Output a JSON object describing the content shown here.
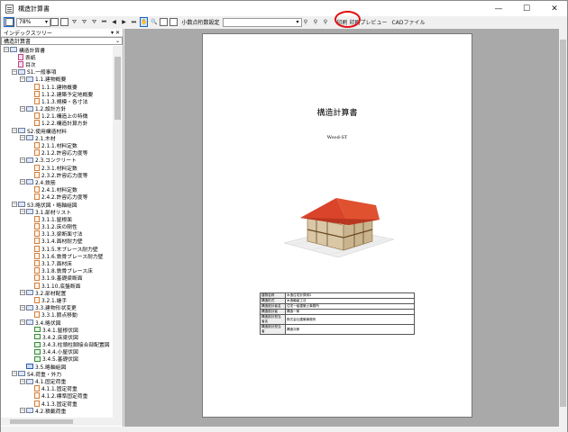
{
  "window": {
    "title": "構造計算書",
    "minimize": "—",
    "maximize": "☐",
    "close": "✕"
  },
  "toolbar": {
    "zoom": "78%",
    "decimal_label": "小数点桁数設定",
    "decimal_value": "",
    "print_label": "印刷",
    "preview_label": "印刷プレビュー",
    "cad_label": "CADファイル",
    "nav_icons": [
      "⏮",
      "◀",
      "▶",
      "⏭"
    ]
  },
  "panel": {
    "title": "インデックスツリー",
    "pin": "▾ ✕",
    "root": "構造計算書"
  },
  "tree": [
    {
      "lv": 0,
      "exp": "−",
      "icon": "folder",
      "label": "構造計算書"
    },
    {
      "lv": 1,
      "exp": "",
      "icon": "pink",
      "label": "表紙"
    },
    {
      "lv": 1,
      "exp": "",
      "icon": "pink",
      "label": "目次"
    },
    {
      "lv": 1,
      "exp": "−",
      "icon": "folder",
      "label": "S1.一般事項"
    },
    {
      "lv": 2,
      "exp": "−",
      "icon": "folder",
      "label": "1.1.建物概要"
    },
    {
      "lv": 3,
      "exp": "",
      "icon": "doc",
      "label": "1.1.1.建物概要"
    },
    {
      "lv": 3,
      "exp": "",
      "icon": "doc",
      "label": "1.1.2.建築予定地概要"
    },
    {
      "lv": 3,
      "exp": "",
      "icon": "doc",
      "label": "1.1.3.規模・各寸法"
    },
    {
      "lv": 2,
      "exp": "−",
      "icon": "folder",
      "label": "1.2.設計方針"
    },
    {
      "lv": 3,
      "exp": "",
      "icon": "doc",
      "label": "1.2.1.構造上の特徴"
    },
    {
      "lv": 3,
      "exp": "",
      "icon": "doc",
      "label": "1.2.2.構造計算方針"
    },
    {
      "lv": 1,
      "exp": "−",
      "icon": "folder",
      "label": "S2.使用構造材料"
    },
    {
      "lv": 2,
      "exp": "−",
      "icon": "folder",
      "label": "2.1.木材"
    },
    {
      "lv": 3,
      "exp": "",
      "icon": "doc",
      "label": "2.1.1.材料定数"
    },
    {
      "lv": 3,
      "exp": "",
      "icon": "doc",
      "label": "2.1.2.許容応力度等"
    },
    {
      "lv": 2,
      "exp": "−",
      "icon": "folder",
      "label": "2.3.コンクリート"
    },
    {
      "lv": 3,
      "exp": "",
      "icon": "doc",
      "label": "2.3.1.材料定数"
    },
    {
      "lv": 3,
      "exp": "",
      "icon": "doc",
      "label": "2.3.2.許容応力度等"
    },
    {
      "lv": 2,
      "exp": "−",
      "icon": "folder",
      "label": "2.4.鉄筋"
    },
    {
      "lv": 3,
      "exp": "",
      "icon": "doc",
      "label": "2.4.1.材料定数"
    },
    {
      "lv": 3,
      "exp": "",
      "icon": "doc",
      "label": "2.4.2.許容応力度等"
    },
    {
      "lv": 1,
      "exp": "−",
      "icon": "folder",
      "label": "S3.略伏図・略軸組図"
    },
    {
      "lv": 2,
      "exp": "−",
      "icon": "folder",
      "label": "3.1.部材リスト"
    },
    {
      "lv": 3,
      "exp": "",
      "icon": "doc",
      "label": "3.1.1.屋根面"
    },
    {
      "lv": 3,
      "exp": "",
      "icon": "doc",
      "label": "3.1.2.床の剛性"
    },
    {
      "lv": 3,
      "exp": "",
      "icon": "doc",
      "label": "3.1.3.梁断面寸法"
    },
    {
      "lv": 3,
      "exp": "",
      "icon": "doc",
      "label": "3.1.4.面材耐力壁"
    },
    {
      "lv": 3,
      "exp": "",
      "icon": "doc",
      "label": "3.1.5.木ブレース耐力壁"
    },
    {
      "lv": 3,
      "exp": "",
      "icon": "doc",
      "label": "3.1.6.鉄骨ブレース耐力壁"
    },
    {
      "lv": 3,
      "exp": "",
      "icon": "doc",
      "label": "3.1.7.面材床"
    },
    {
      "lv": 3,
      "exp": "",
      "icon": "doc",
      "label": "3.1.8.鉄骨ブレース床"
    },
    {
      "lv": 3,
      "exp": "",
      "icon": "doc",
      "label": "3.1.9.基礎梁断面"
    },
    {
      "lv": 3,
      "exp": "",
      "icon": "doc",
      "label": "3.1.10.底盤断面"
    },
    {
      "lv": 2,
      "exp": "−",
      "icon": "folder",
      "label": "3.2.部材配置"
    },
    {
      "lv": 3,
      "exp": "",
      "icon": "doc",
      "label": "3.2.1.継手"
    },
    {
      "lv": 2,
      "exp": "−",
      "icon": "folder",
      "label": "3.3.建物形状変更"
    },
    {
      "lv": 3,
      "exp": "",
      "icon": "doc",
      "label": "3.3.1.節点移動"
    },
    {
      "lv": 2,
      "exp": "−",
      "icon": "folder",
      "label": "3.4.略伏図"
    },
    {
      "lv": 3,
      "exp": "",
      "icon": "grn",
      "label": "3.4.1.屋根伏図"
    },
    {
      "lv": 3,
      "exp": "",
      "icon": "grn",
      "label": "3.4.2.床梁伏図"
    },
    {
      "lv": 3,
      "exp": "",
      "icon": "grn",
      "label": "3.4.3.柱頭柱脚接合部配置図"
    },
    {
      "lv": 3,
      "exp": "",
      "icon": "grn",
      "label": "3.4.4.小屋伏図"
    },
    {
      "lv": 3,
      "exp": "",
      "icon": "grn",
      "label": "3.4.5.基礎伏図"
    },
    {
      "lv": 2,
      "exp": "",
      "icon": "img",
      "label": "3.5.略軸組図"
    },
    {
      "lv": 1,
      "exp": "−",
      "icon": "folder",
      "label": "S4.荷重・外力"
    },
    {
      "lv": 2,
      "exp": "−",
      "icon": "folder",
      "label": "4.1.固定荷重"
    },
    {
      "lv": 3,
      "exp": "",
      "icon": "doc",
      "label": "4.1.1.固定荷重"
    },
    {
      "lv": 3,
      "exp": "",
      "icon": "doc",
      "label": "4.1.2.標準固定荷重"
    },
    {
      "lv": 3,
      "exp": "",
      "icon": "doc",
      "label": "4.1.3.固定荷重"
    },
    {
      "lv": 2,
      "exp": "−",
      "icon": "folder",
      "label": "4.2.積載荷重"
    }
  ],
  "document": {
    "title": "構造計算書",
    "subtitle": "Wood-ST",
    "info": [
      {
        "k": "建物名称",
        "v": "木造住宅計算例2"
      },
      {
        "k": "構造形式",
        "v": "木造軸組工法"
      },
      {
        "k": "構造設計者名",
        "v": "住宅一級建築士事務所"
      },
      {
        "k": "構造設計者",
        "v": "構造一郎"
      },
      {
        "k": "構造設計担当者名",
        "v": "株式会社建築事務所"
      },
      {
        "k": "構造設計担当者",
        "v": "構造次郎"
      }
    ]
  }
}
